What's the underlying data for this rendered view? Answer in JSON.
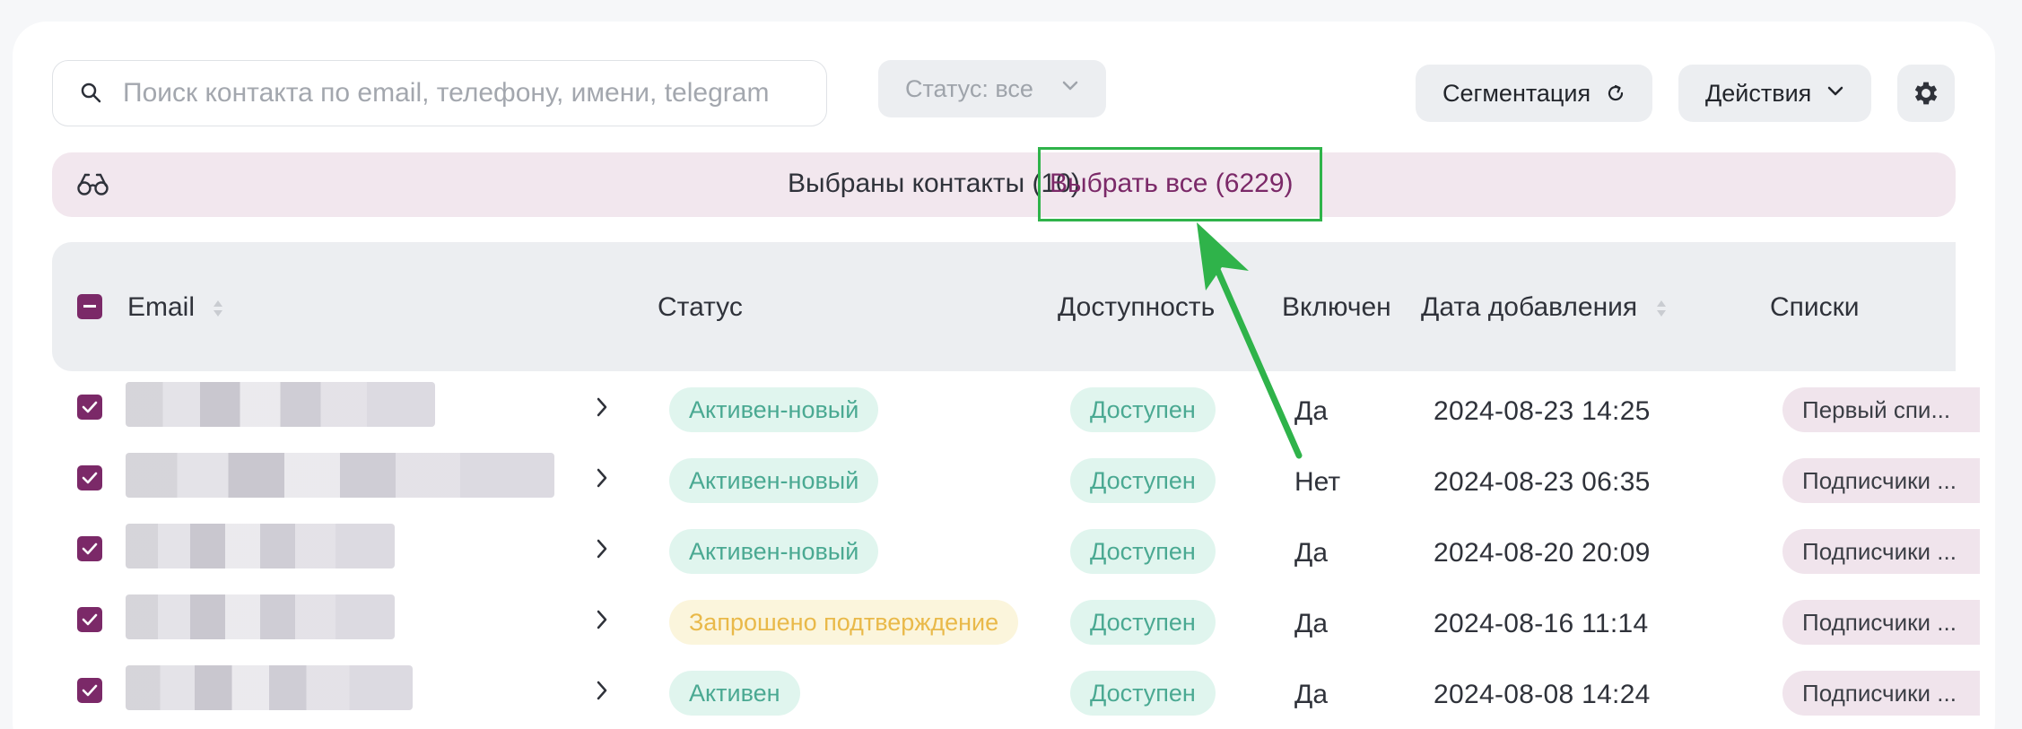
{
  "search": {
    "placeholder": "Поиск контакта по email, телефону, имени, telegram",
    "value": ""
  },
  "filters": {
    "status_label": "Статус: все"
  },
  "toolbar": {
    "segmentation_label": "Сегментация",
    "actions_label": "Действия"
  },
  "selection": {
    "selected_text": "Выбраны контакты (10).",
    "select_all_label": "Выбрать все (6229)"
  },
  "table": {
    "columns": {
      "email": "Email",
      "status": "Статус",
      "availability": "Доступность",
      "enabled": "Включен",
      "date_added": "Дата добавления",
      "lists": "Списки"
    },
    "rows": [
      {
        "status": "Активен-новый",
        "status_kind": "green",
        "availability": "Доступен",
        "enabled": "Да",
        "date": "2024-08-23 14:25",
        "list": "Первый спи..."
      },
      {
        "status": "Активен-новый",
        "status_kind": "green",
        "availability": "Доступен",
        "enabled": "Нет",
        "date": "2024-08-23 06:35",
        "list": "Подписчики ..."
      },
      {
        "status": "Активен-новый",
        "status_kind": "green",
        "availability": "Доступен",
        "enabled": "Да",
        "date": "2024-08-20 20:09",
        "list": "Подписчики ..."
      },
      {
        "status": "Запрошено подтверждение",
        "status_kind": "yellow",
        "availability": "Доступен",
        "enabled": "Да",
        "date": "2024-08-16 11:14",
        "list": "Подписчики ..."
      },
      {
        "status": "Активен",
        "status_kind": "green",
        "availability": "Доступен",
        "enabled": "Да",
        "date": "2024-08-08 14:24",
        "list": "Подписчики ..."
      }
    ]
  },
  "colors": {
    "accent": "#7b2968",
    "banner_bg": "#f2e7ee",
    "pill_green_bg": "#e0f5ee",
    "pill_green_text": "#4aa992",
    "pill_yellow_bg": "#fbf5dc",
    "pill_yellow_text": "#e9b949",
    "highlight": "#2fb34a"
  },
  "icons": [
    "search-icon",
    "chevron-down-icon",
    "refresh-icon",
    "gear-icon",
    "glasses-icon",
    "sort-icon",
    "chevron-right-icon",
    "check-icon"
  ]
}
